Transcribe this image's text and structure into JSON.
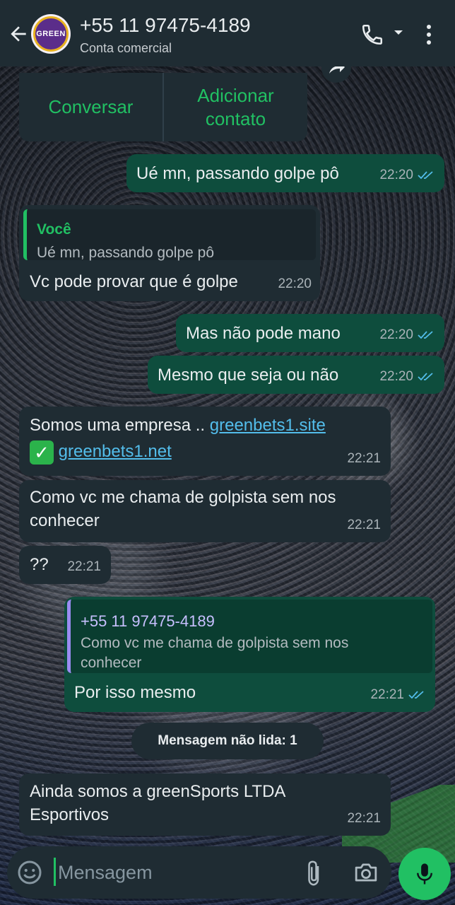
{
  "header": {
    "contact_name": "+55 11 97475-4189",
    "contact_subtitle": "Conta comercial",
    "avatar_text": "GREEN"
  },
  "business_actions": {
    "chat_label": "Conversar",
    "add_contact_label_1": "Adicionar",
    "add_contact_label_2": "contato"
  },
  "messages": [
    {
      "direction": "out",
      "text": "Ué mn, passando golpe pô",
      "time": "22:20",
      "status": "read"
    },
    {
      "direction": "in",
      "quote_name": "Você",
      "quote_text": "Ué mn, passando golpe pô",
      "text": "Vc pode provar que é golpe",
      "time": "22:20"
    },
    {
      "direction": "out",
      "text": "Mas não pode mano",
      "time": "22:20",
      "status": "read"
    },
    {
      "direction": "out",
      "text": "Mesmo que seja ou não",
      "time": "22:20",
      "status": "read"
    },
    {
      "direction": "in",
      "text_prefix": "Somos uma empresa .. ",
      "link_1": "greenbets1.site",
      "check_emoji": "✅",
      "link_2": "greenbets1.net",
      "time": "22:21"
    },
    {
      "direction": "in",
      "text_line_1": "Como vc me chama de golpista sem nos",
      "text_line_2": "conhecer",
      "time": "22:21"
    },
    {
      "direction": "in",
      "text": "??",
      "time": "22:21"
    },
    {
      "direction": "out",
      "quote_name": "+55 11 97475-4189",
      "quote_line_1": "Como vc me chama de golpista sem nos",
      "quote_line_2": "conhecer",
      "text": "Por isso mesmo",
      "time": "22:21",
      "status": "read"
    },
    {
      "direction": "in",
      "text_line_1": "Ainda somos a greenSports LTDA",
      "text_line_2": "Esportivos",
      "time": "22:21"
    }
  ],
  "unread_banner": "Mensagem não lida: 1",
  "composer": {
    "placeholder": "Mensagem"
  },
  "colors": {
    "accent_green": "#21c063",
    "incoming_bubble": "#1f2c33",
    "outgoing_bubble": "#0e4d3d",
    "read_ticks": "#53bdeb",
    "link": "#53bdeb"
  },
  "icons": [
    "back-arrow-icon",
    "call-icon",
    "caret-down-icon",
    "more-vert-icon",
    "forward-icon",
    "emoji-icon",
    "attach-icon",
    "camera-icon",
    "mic-icon"
  ]
}
